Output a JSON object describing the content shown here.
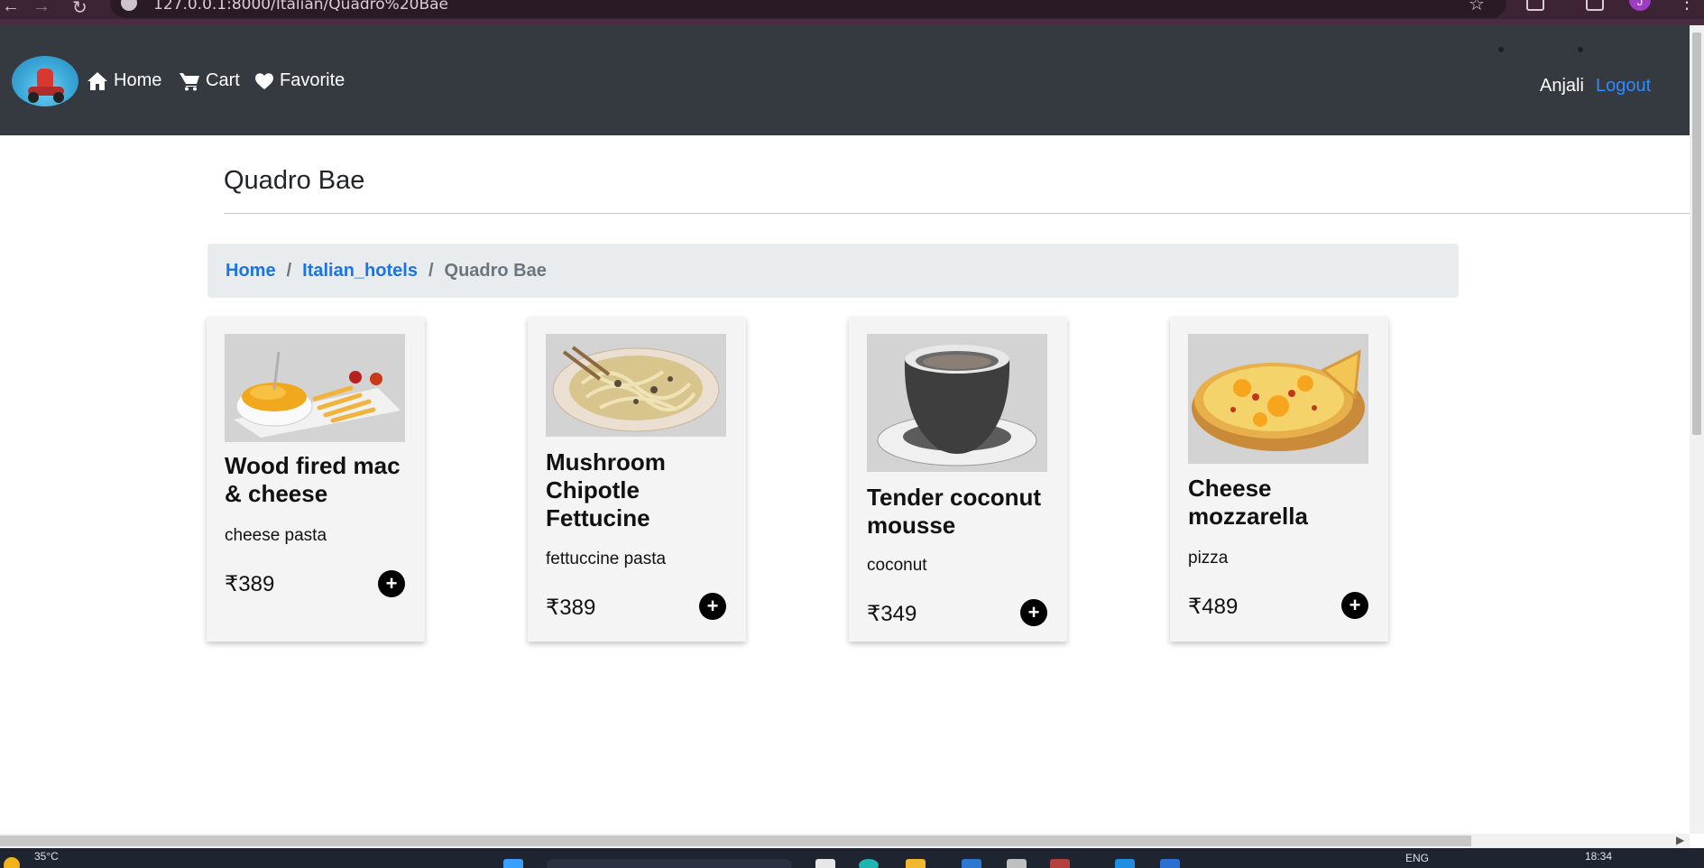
{
  "browser": {
    "url": "127.0.0.1:8000/Italian/Quadro%20Bae",
    "profile_initial": "J"
  },
  "header": {
    "nav": [
      {
        "label": "Home",
        "icon": "home-icon"
      },
      {
        "label": "Cart",
        "icon": "cart-icon"
      },
      {
        "label": "Favorite",
        "icon": "heart-icon"
      }
    ],
    "user": "Anjali",
    "logout": "Logout"
  },
  "page": {
    "title": "Quadro Bae"
  },
  "breadcrumb": {
    "items": [
      "Home",
      "Italian_hotels",
      "Quadro Bae"
    ],
    "separator": "/"
  },
  "products": [
    {
      "name": "Wood fired mac & cheese",
      "description": "cheese pasta",
      "price": "₹389",
      "add": "+",
      "image": "mac-and-cheese-image"
    },
    {
      "name": "Mushroom Chipotle Fettucine",
      "description": "fettuccine pasta",
      "price": "₹389",
      "add": "+",
      "image": "fettuccine-image"
    },
    {
      "name": "Tender coconut mousse",
      "description": "coconut",
      "price": "₹349",
      "add": "+",
      "image": "coconut-mousse-image"
    },
    {
      "name": "Cheese mozzarella",
      "description": "pizza",
      "price": "₹489",
      "add": "+",
      "image": "pizza-image"
    }
  ],
  "taskbar": {
    "temperature": "35°C",
    "language": "ENG",
    "time": "18:34"
  },
  "colors": {
    "header_bg": "#343a40",
    "link": "#1a73e8",
    "logout": "#2f8cff",
    "breadcrumb_bg": "#e9ecef",
    "card_bg": "#f4f4f4"
  }
}
